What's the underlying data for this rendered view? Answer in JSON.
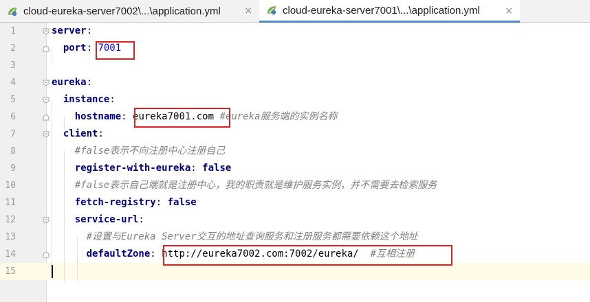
{
  "tabs": [
    {
      "label": "cloud-eureka-server7002\\...\\application.yml",
      "close": "×",
      "icon": "yaml-file-icon"
    },
    {
      "label": "cloud-eureka-server7001\\...\\application.yml",
      "close": "×",
      "icon": "yaml-file-icon",
      "active": true
    }
  ],
  "lines": [
    {
      "n": "1",
      "tokens": [
        {
          "t": "server",
          "c": "key"
        },
        {
          "t": ":",
          "c": "val"
        }
      ]
    },
    {
      "n": "2",
      "tokens": [
        {
          "t": "  "
        },
        {
          "t": "port",
          "c": "key"
        },
        {
          "t": ": ",
          "c": "val"
        },
        {
          "t": "7001",
          "c": "num"
        }
      ]
    },
    {
      "n": "3",
      "tokens": []
    },
    {
      "n": "4",
      "tokens": [
        {
          "t": "eureka",
          "c": "key"
        },
        {
          "t": ":",
          "c": "val"
        }
      ]
    },
    {
      "n": "5",
      "tokens": [
        {
          "t": "  "
        },
        {
          "t": "instance",
          "c": "key"
        },
        {
          "t": ":",
          "c": "val"
        }
      ]
    },
    {
      "n": "6",
      "tokens": [
        {
          "t": "    "
        },
        {
          "t": "hostname",
          "c": "key"
        },
        {
          "t": ": ",
          "c": "val"
        },
        {
          "t": "eureka7001.com",
          "c": "val"
        },
        {
          "t": " "
        },
        {
          "t": "#eureka服务端的实例名称",
          "c": "cmt"
        }
      ]
    },
    {
      "n": "7",
      "tokens": [
        {
          "t": "  "
        },
        {
          "t": "client",
          "c": "key"
        },
        {
          "t": ":",
          "c": "val"
        }
      ]
    },
    {
      "n": "8",
      "tokens": [
        {
          "t": "    "
        },
        {
          "t": "#false表示不向注册中心注册自己",
          "c": "cmt"
        }
      ]
    },
    {
      "n": "9",
      "tokens": [
        {
          "t": "    "
        },
        {
          "t": "register-with-eureka",
          "c": "key"
        },
        {
          "t": ": ",
          "c": "val"
        },
        {
          "t": "false",
          "c": "kw"
        }
      ]
    },
    {
      "n": "10",
      "tokens": [
        {
          "t": "    "
        },
        {
          "t": "#false表示自己端就是注册中心，我的职责就是维护服务实例，并不需要去检索服务",
          "c": "cmt"
        }
      ]
    },
    {
      "n": "11",
      "tokens": [
        {
          "t": "    "
        },
        {
          "t": "fetch-registry",
          "c": "key"
        },
        {
          "t": ": ",
          "c": "val"
        },
        {
          "t": "false",
          "c": "kw"
        }
      ]
    },
    {
      "n": "12",
      "tokens": [
        {
          "t": "    "
        },
        {
          "t": "service-url",
          "c": "key"
        },
        {
          "t": ":",
          "c": "val"
        }
      ]
    },
    {
      "n": "13",
      "tokens": [
        {
          "t": "      "
        },
        {
          "t": "#设置与Eureka Server交互的地址查询服务和注册服务都需要依赖这个地址",
          "c": "cmt"
        }
      ]
    },
    {
      "n": "14",
      "tokens": [
        {
          "t": "      "
        },
        {
          "t": "defaultZone",
          "c": "key"
        },
        {
          "t": ": ",
          "c": "val"
        },
        {
          "t": "http://eureka7002.com:7002/eureka/",
          "c": "val"
        },
        {
          "t": "  "
        },
        {
          "t": "#互相注册",
          "c": "cmt"
        }
      ]
    },
    {
      "n": "15",
      "tokens": [],
      "current": true
    }
  ]
}
